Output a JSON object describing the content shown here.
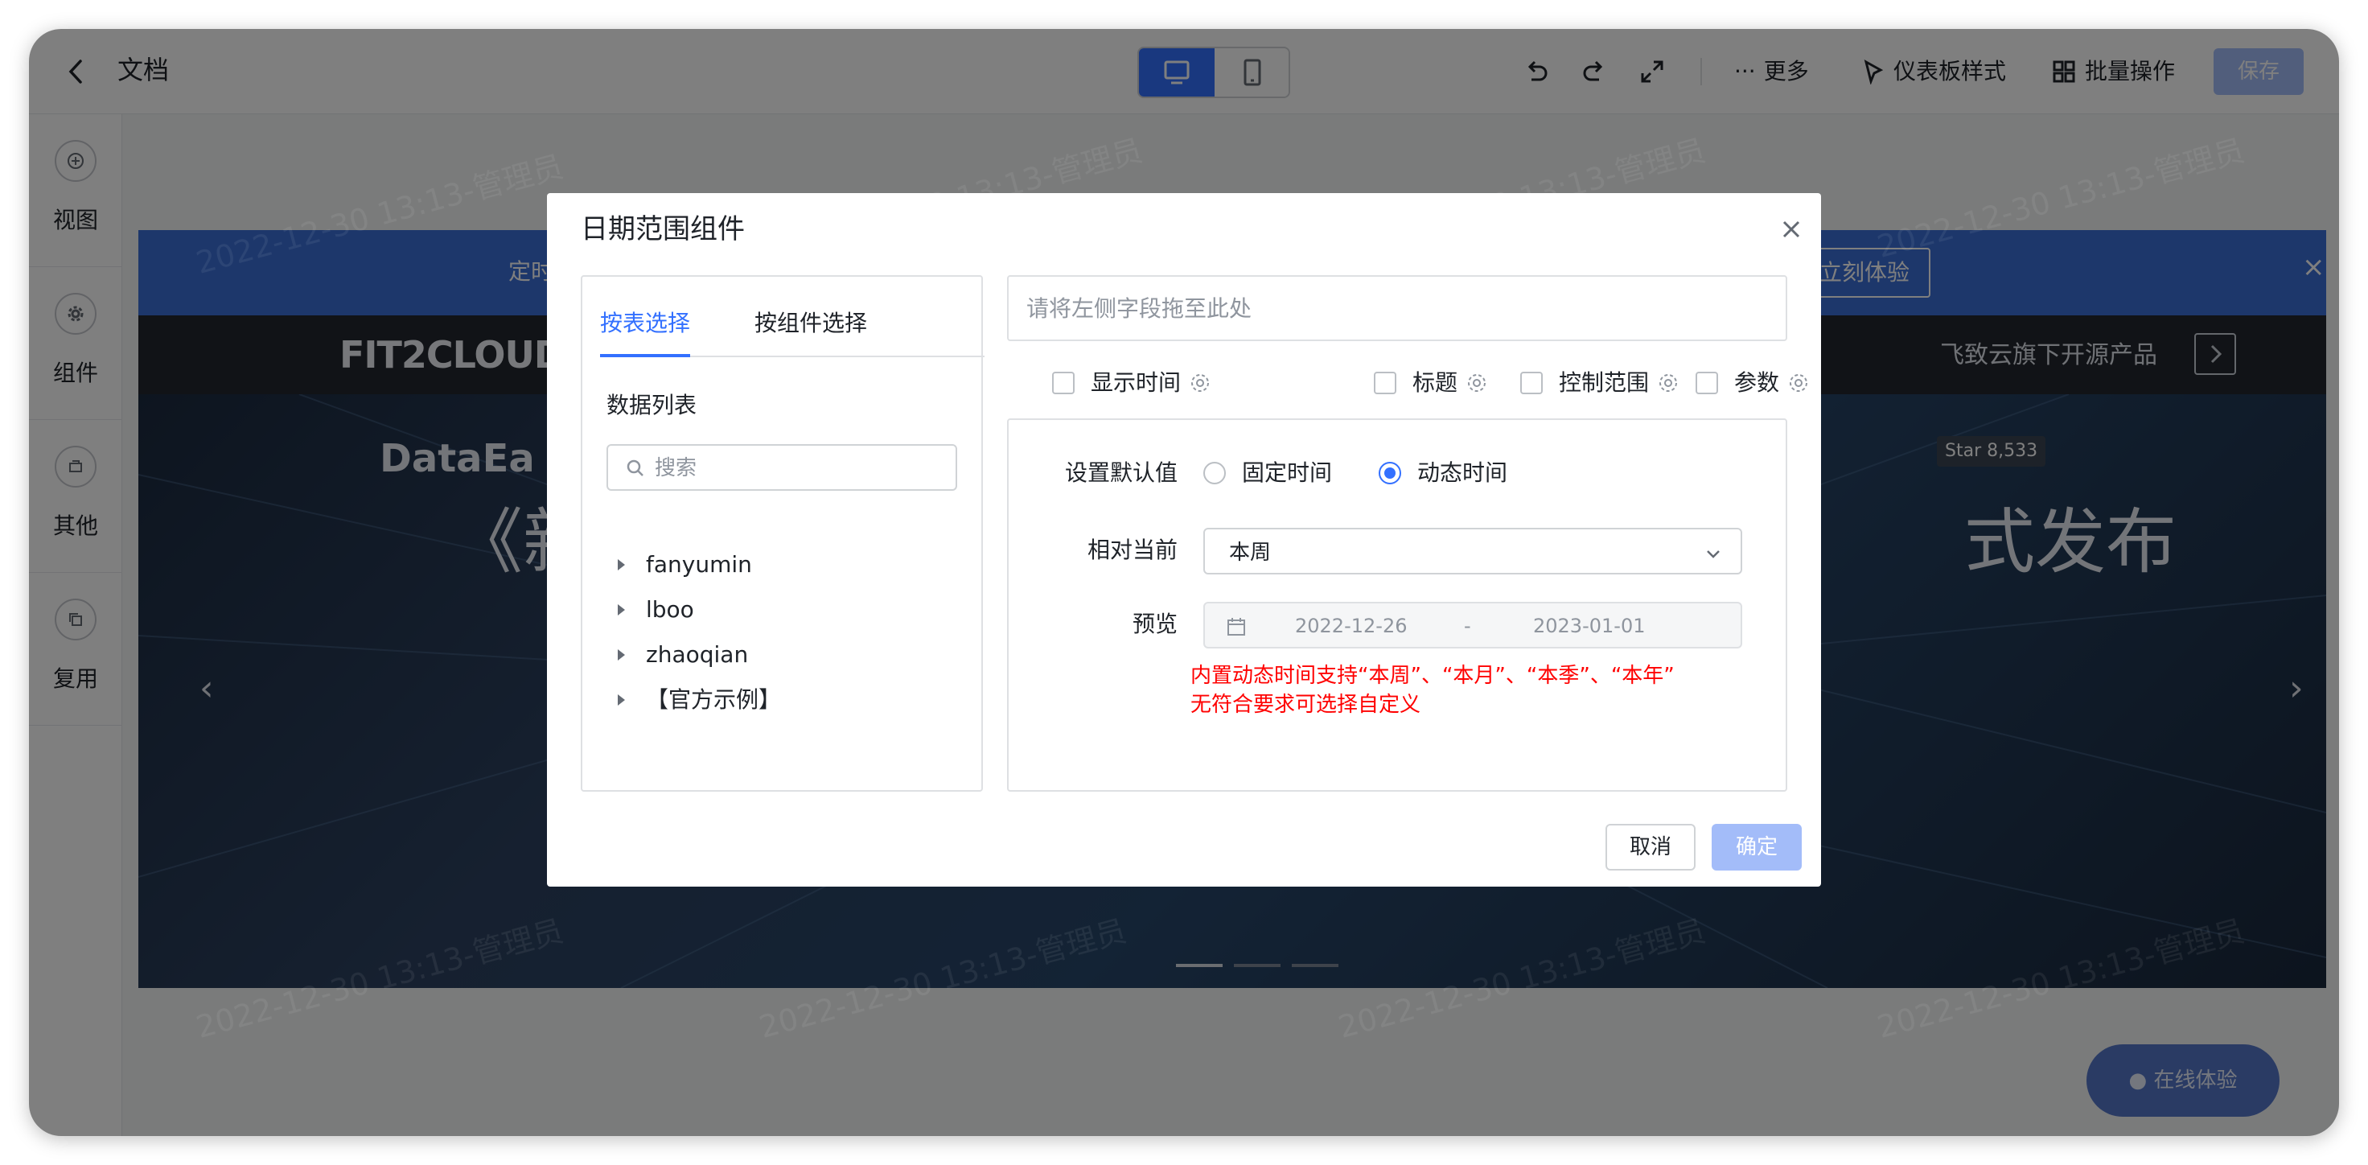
{
  "header": {
    "back_icon": "chevron-left-icon",
    "title": "文档",
    "view_modes": [
      "desktop-icon",
      "mobile-icon"
    ],
    "tools": {
      "undo_icon": "undo-icon",
      "redo_icon": "redo-icon",
      "fullscreen_icon": "expand-icon",
      "more_label": "更多",
      "style_label": "仪表板样式",
      "batch_label": "批量操作",
      "save_label": "保存"
    }
  },
  "rail": {
    "items": [
      {
        "label": "视图",
        "icon": "plus-circle-icon"
      },
      {
        "label": "组件",
        "icon": "gear-icon"
      },
      {
        "label": "其他",
        "icon": "box-icon"
      },
      {
        "label": "复用",
        "icon": "copy-icon"
      }
    ]
  },
  "canvas": {
    "watermark": "2022-12-30 13:13-管理员",
    "banner_left": "定时",
    "banner_button": "立刻体验",
    "brand": "FIT2CLOUD",
    "strip_right": "飞致云旗下开源产品",
    "hero_logo": "DataEa",
    "hero_title_left": "《新",
    "hero_title_right": "式发布",
    "hero_star": "Star  8,533",
    "fab_label": "在线体验"
  },
  "dialog": {
    "title": "日期范围组件",
    "tabs": [
      "按表选择",
      "按组件选择"
    ],
    "list_title": "数据列表",
    "search_placeholder": "搜索",
    "tree": [
      "fanyumin",
      "lboo",
      "zhaoqian",
      "【官方示例】"
    ],
    "drop_placeholder": "请将左侧字段拖至此处",
    "options": {
      "show_time": "显示时间",
      "title": "标题",
      "control_range": "控制范围",
      "params": "参数"
    },
    "default_label": "设置默认值",
    "radio_fixed": "固定时间",
    "radio_dynamic": "动态时间",
    "relative_label": "相对当前",
    "relative_value": "本周",
    "preview_label": "预览",
    "preview_start": "2022-12-26",
    "preview_sep": "-",
    "preview_end": "2023-01-01",
    "note_line1": "内置动态时间支持“本周”、“本月”、“本季”、“本年”",
    "note_line2": "无符合要求可选择自定义",
    "cancel_label": "取消",
    "ok_label": "确定"
  },
  "colors": {
    "accent": "#3370ff",
    "save_disabled": "#a3bcf9",
    "note_red": "#ff0000"
  }
}
